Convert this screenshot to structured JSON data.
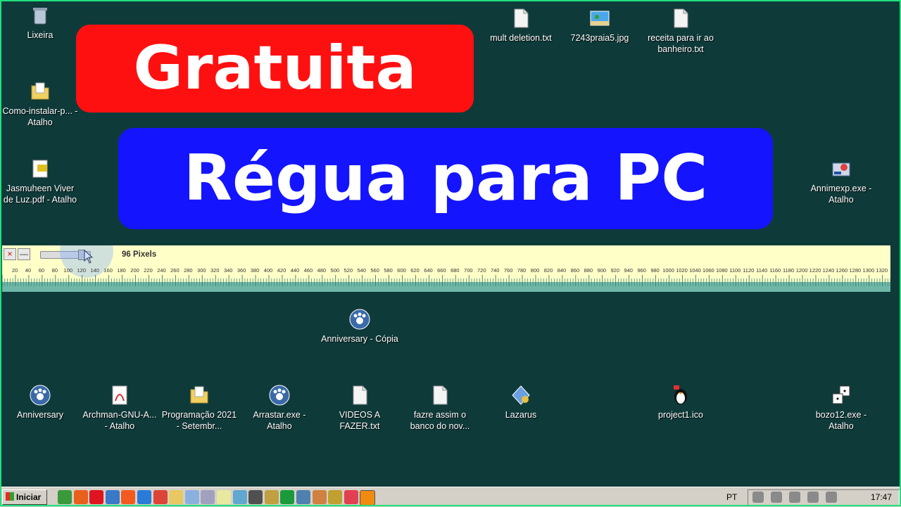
{
  "banners": {
    "top": "Gratuita",
    "bottom": "Régua para PC"
  },
  "ruler": {
    "close_glyph": "×",
    "minimize_glyph": "—",
    "slider_fraction": 0.85,
    "pixels_label": "96 Pixels",
    "tick_labels": [
      "20",
      "40",
      "60",
      "80",
      "100",
      "120",
      "140",
      "160",
      "180",
      "200",
      "220",
      "240",
      "260",
      "280",
      "300",
      "320",
      "340",
      "360",
      "380",
      "400",
      "420",
      "440",
      "460",
      "480",
      "500",
      "520",
      "540",
      "560",
      "580",
      "600",
      "620",
      "640",
      "660",
      "680",
      "700",
      "720",
      "740",
      "760",
      "780",
      "800",
      "820",
      "840",
      "860",
      "880",
      "900",
      "920",
      "940",
      "960",
      "980",
      "1000",
      "1020",
      "1040",
      "1060",
      "1080",
      "1100",
      "1120",
      "1140",
      "1160",
      "1180",
      "1200",
      "1220",
      "1240",
      "1260",
      "1280",
      "1300",
      "1320",
      "134"
    ]
  },
  "desktop_icons": [
    {
      "id": "lixeira",
      "label": "Lixeira",
      "icon": "recycle-bin-icon"
    },
    {
      "id": "como-instalar",
      "label": "Como-instalar-p... - Atalho",
      "icon": "folder-shortcut-icon"
    },
    {
      "id": "jasmuheen",
      "label": "Jasmuheen Viver de Luz.pdf - Atalho",
      "icon": "pdf-shortcut-icon"
    },
    {
      "id": "mult-deletion",
      "label": "mult deletion.txt",
      "icon": "text-file-icon"
    },
    {
      "id": "praia",
      "label": "7243praia5.jpg",
      "icon": "image-file-icon"
    },
    {
      "id": "receita",
      "label": "receita para ir ao banheiro.txt",
      "icon": "text-file-icon"
    },
    {
      "id": "annimexp",
      "label": "Annimexp.exe - Atalho",
      "icon": "exe-shortcut-icon"
    },
    {
      "id": "anniversary-copia",
      "label": "Anniversary - Cópia",
      "icon": "paw-shortcut-icon"
    },
    {
      "id": "anniversary",
      "label": "Anniversary",
      "icon": "paw-shortcut-icon"
    },
    {
      "id": "archman",
      "label": "Archman-GNU-A... - Atalho",
      "icon": "document-shortcut-icon"
    },
    {
      "id": "programacao",
      "label": "Programação 2021 - Setembr...",
      "icon": "folder-shortcut-icon"
    },
    {
      "id": "arrastar",
      "label": "Arrastar.exe - Atalho",
      "icon": "paw-shortcut-icon"
    },
    {
      "id": "videos",
      "label": "VIDEOS A FAZER.txt",
      "icon": "text-file-icon"
    },
    {
      "id": "fazre",
      "label": "fazre assim o banco do nov...",
      "icon": "text-file-icon"
    },
    {
      "id": "lazarus",
      "label": "Lazarus",
      "icon": "lazarus-icon"
    },
    {
      "id": "project1",
      "label": "project1.ico",
      "icon": "penguin-icon"
    },
    {
      "id": "bozo12",
      "label": "bozo12.exe - Atalho",
      "icon": "dice-shortcut-icon"
    }
  ],
  "taskbar": {
    "start_label": "Iniciar",
    "apps": [
      {
        "name": "paint-icon",
        "color": "#3a9a3a"
      },
      {
        "name": "firefox-icon",
        "color": "#e8601c"
      },
      {
        "name": "opera-icon",
        "color": "#e0141e"
      },
      {
        "name": "chromium-icon",
        "color": "#3a78c8"
      },
      {
        "name": "brave-icon",
        "color": "#f25a20"
      },
      {
        "name": "chrome-blue-icon",
        "color": "#2a7ad8"
      },
      {
        "name": "chrome-icon",
        "color": "#db4437"
      },
      {
        "name": "explorer-folder-icon",
        "color": "#e8c860"
      },
      {
        "name": "notepad-icon",
        "color": "#8ab0e0"
      },
      {
        "name": "brush-icon",
        "color": "#a0a0c0"
      },
      {
        "name": "notes-icon",
        "color": "#e8e8a0"
      },
      {
        "name": "eraser-icon",
        "color": "#60a8d0"
      },
      {
        "name": "search-icon",
        "color": "#505050"
      },
      {
        "name": "edit-icon",
        "color": "#c0a040"
      },
      {
        "name": "brazil-flag-icon",
        "color": "#1a9a3a"
      },
      {
        "name": "network-icon",
        "color": "#5080b0"
      },
      {
        "name": "clock-app-icon",
        "color": "#d08040"
      },
      {
        "name": "measure-icon",
        "color": "#c0a030"
      },
      {
        "name": "target-icon",
        "color": "#e04050"
      },
      {
        "name": "vlc-icon",
        "color": "#f08a10"
      }
    ],
    "language": "PT",
    "tray_icons": [
      "vlc-tray-icon",
      "panda-icon",
      "flag-icon",
      "network-tray-icon",
      "volume-icon"
    ],
    "clock": "17:47"
  }
}
